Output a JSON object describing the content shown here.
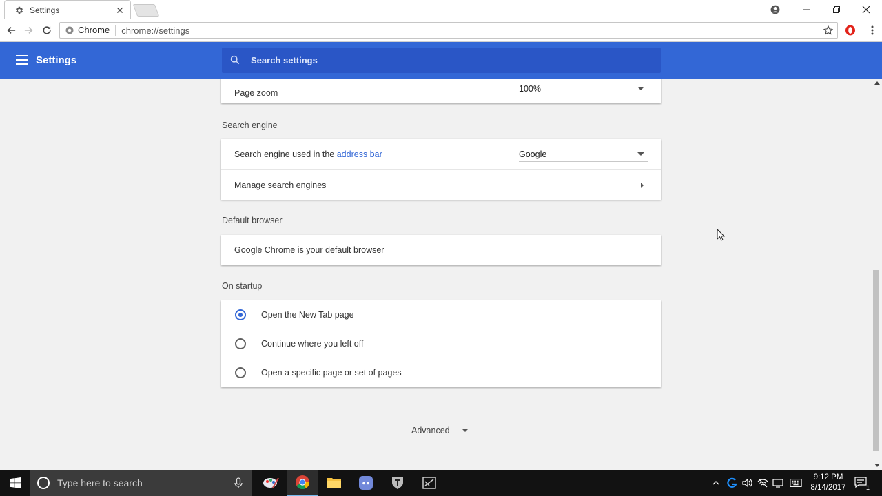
{
  "browser": {
    "tab_title": "Settings",
    "origin_label": "Chrome",
    "url": "chrome://settings"
  },
  "settings": {
    "header_title": "Settings",
    "search_placeholder": "Search settings",
    "page_zoom": {
      "label": "Page zoom",
      "value": "100%"
    },
    "search_engine": {
      "section_title": "Search engine",
      "used_label_prefix": "Search engine used in the",
      "used_label_link": "address bar",
      "value": "Google",
      "manage_label": "Manage search engines"
    },
    "default_browser": {
      "section_title": "Default browser",
      "status": "Google Chrome is your default browser"
    },
    "on_startup": {
      "section_title": "On startup",
      "options": [
        {
          "label": "Open the New Tab page",
          "checked": true
        },
        {
          "label": "Continue where you left off",
          "checked": false
        },
        {
          "label": "Open a specific page or set of pages",
          "checked": false
        }
      ]
    },
    "advanced_label": "Advanced"
  },
  "taskbar": {
    "search_placeholder": "Type here to search",
    "time": "9:12 PM",
    "date": "8/14/2017",
    "notification_count": "1"
  },
  "colors": {
    "accent": "#3367d6",
    "search_box": "#2a56c6",
    "taskbar": "#121212"
  }
}
